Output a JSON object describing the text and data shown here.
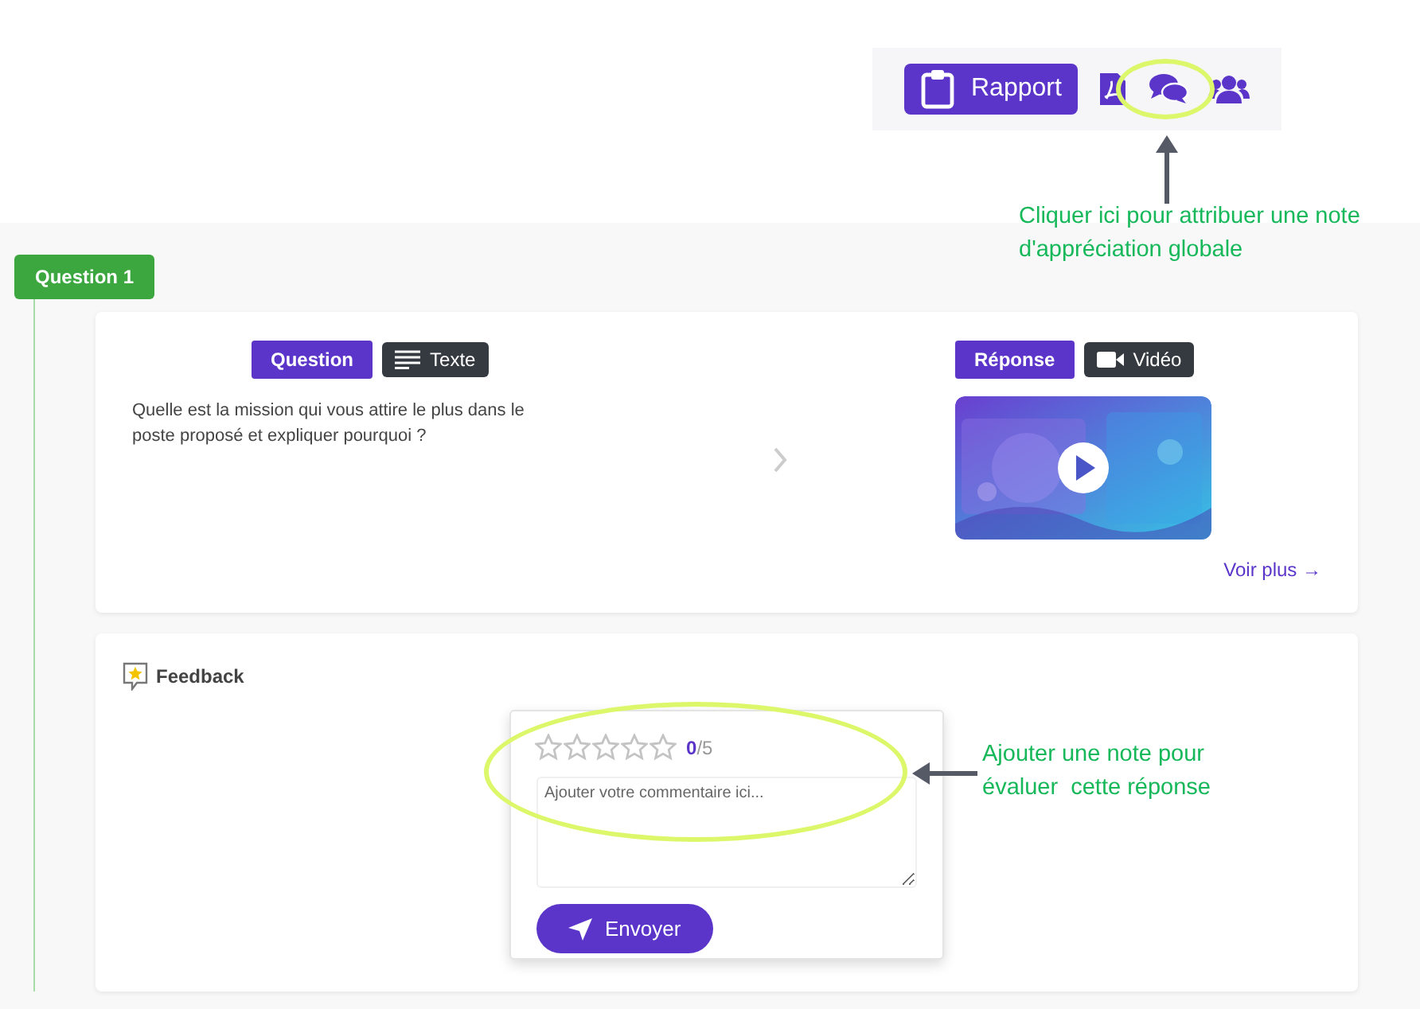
{
  "toolbar": {
    "report_button": {
      "label": "Rapport"
    }
  },
  "annotations": [
    {
      "text": "Cliquer ici pour attribuer une note d'appréciation globale"
    },
    {
      "text": "Ajouter une note pour évaluer  cette réponse"
    }
  ],
  "question": {
    "badge": "Question 1",
    "prompt": {
      "label": "Question",
      "type": "Texte",
      "text": "Quelle est la mission qui vous attire le plus dans le poste proposé et expliquer pourquoi ?"
    },
    "response": {
      "label": "Réponse",
      "type": "Vidéo",
      "link": "Voir plus →"
    }
  },
  "feedback": {
    "title": "Feedback",
    "stars": 0,
    "score": "0",
    "out_of": "/5",
    "placeholder": "Ajouter votre commentaire ici...",
    "send_button": "Envoyer"
  }
}
